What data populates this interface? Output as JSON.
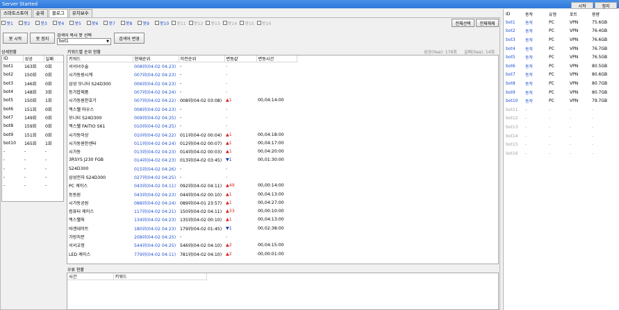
{
  "window": {
    "title": "Server Started"
  },
  "top_buttons": {
    "start": "시작",
    "stop": "정지"
  },
  "tabs": [
    "스마트스토어",
    "순위",
    "블로그",
    "유지보수"
  ],
  "bot_checks": [
    "봇1",
    "봇2",
    "봇3",
    "봇4",
    "봇5",
    "봇6",
    "봇7",
    "봇8",
    "봇9",
    "봇10",
    "봇11",
    "봇12",
    "봇13",
    "봇14",
    "봇15",
    "봇16"
  ],
  "controls": {
    "bot_start": "봇 시작",
    "bot_stop": "봇 정지",
    "copy_label": "검색어 복사 봇 선택",
    "selected_bot": "bot1",
    "change_keyword": "검색어 변경",
    "select_all": "전체선택",
    "deselect_all": "전체해제"
  },
  "detail": {
    "title": "상세현황",
    "headers": [
      "ID",
      "성공",
      "실패"
    ],
    "rows": [
      [
        "bot1",
        "163회",
        "0회"
      ],
      [
        "bot2",
        "150회",
        "0회"
      ],
      [
        "bot3",
        "146회",
        "0회"
      ],
      [
        "bot4",
        "148회",
        "3회"
      ],
      [
        "bot5",
        "150회",
        "1회"
      ],
      [
        "bot6",
        "151회",
        "0회"
      ],
      [
        "bot7",
        "149회",
        "0회"
      ],
      [
        "bot8",
        "159회",
        "0회"
      ],
      [
        "bot9",
        "151회",
        "0회"
      ],
      [
        "bot10",
        "165회",
        "1회"
      ],
      [
        "-",
        "-",
        "-"
      ],
      [
        "-",
        "-",
        "-"
      ],
      [
        "-",
        "-",
        "-"
      ],
      [
        "-",
        "-",
        "-"
      ],
      [
        "-",
        "-",
        "-"
      ]
    ]
  },
  "rank": {
    "title": "키워드별 순위 현황",
    "success_count": "성공(0ea): 176회",
    "fail_count": "실패(0ea): 14회",
    "headers": [
      "키워드",
      "현재순위",
      "이전순위",
      "변동값",
      "변동시간"
    ],
    "rows": [
      [
        "서서녀수술",
        "008위(04-02 04:23)",
        "-",
        "-",
        ""
      ],
      [
        "시가동원시계",
        "007위(04-02 04:23)",
        "-",
        "-",
        ""
      ],
      [
        "삼성 모니터 S24D300",
        "006위(04-02 04:23)",
        "-",
        "-",
        ""
      ],
      [
        "등가합체품",
        "007위(04-02 04:24)",
        "-",
        "-",
        ""
      ],
      [
        "시가동원한호기",
        "007위(04-02 04:22)",
        "008위(04-02 03:08)",
        "▲1",
        "00,04:14:00"
      ],
      [
        "맥스웰 마우스",
        "008위(04-02 04:23)",
        "-",
        "-",
        ""
      ],
      [
        "모니터 S24D300",
        "009위(04-02 04:25)",
        "-",
        "-",
        ""
      ],
      [
        "맥스웰 FAITIO S61",
        "010위(04-02 04:25)",
        "-",
        "-",
        ""
      ],
      [
        "시가동이상",
        "010위(04-02 04:22)",
        "011위(04-02 00:04)",
        "▲1",
        "00,04:18:00"
      ],
      [
        "시가동원한센터",
        "011위(04-02 04:24)",
        "012위(04-02 00:07)",
        "▲1",
        "00,04:17:00"
      ],
      [
        "시가동",
        "013위(04-02 04:23)",
        "014위(04-02 00:03)",
        "▲1",
        "00,04:20:00"
      ],
      [
        "3RSYS J230 FGB",
        "014위(04-02 04:23)",
        "013위(04-02 03:45)",
        "▼1",
        "00,01:30:00"
      ],
      [
        "S24D300",
        "015위(04-02 04:26)",
        "-",
        "-",
        ""
      ],
      [
        "삼성전자 S24D300",
        "027위(04-02 04:25)",
        "-",
        "-",
        ""
      ],
      [
        "PC 케이스",
        "043위(04-02 04:11)",
        "092위(04-02 04:11)",
        "▲49",
        "00,00:14:00"
      ],
      [
        "등동원",
        "043위(04-02 04:23)",
        "044위(04-02 00:10)",
        "▲1",
        "00,04:13:00"
      ],
      [
        "시가동공원",
        "088위(04-02 04:24)",
        "089위(04-01 23:57)",
        "▲1",
        "00,04:27:00"
      ],
      [
        "컴퓨터 케이스",
        "117위(04-02 04:21)",
        "150위(04-02 04:11)",
        "▲33",
        "00,00:10:00"
      ],
      [
        "맥스웰육",
        "134위(04-02 04:23)",
        "135위(04-02 00:10)",
        "▲1",
        "00,04:13:00"
      ],
      [
        "바겐데이트",
        "180위(04-02 04:23)",
        "179위(04-02 01:45)",
        "▼1",
        "00,02:38:00"
      ],
      [
        "가방처분",
        "208위(04-02 04:25)",
        "-",
        "-",
        ""
      ],
      [
        "서서교정",
        "544위(04-02 04:25)",
        "546위(04-02 04:10)",
        "▲2",
        "00,04:15:00"
      ],
      [
        "LED 케이스",
        "779위(04-02 04:11)",
        "781위(04-02 04:10)",
        "▲2",
        "00,00:01:00"
      ]
    ]
  },
  "errors": {
    "title": "오류 현황",
    "headers": [
      "시간",
      "키워드"
    ]
  },
  "bot_status": {
    "headers": [
      "ID",
      "동작",
      "유형",
      "포트",
      "용량"
    ],
    "rows": [
      [
        "bot1",
        "동작",
        "PC",
        "VPN",
        "75.6GB"
      ],
      [
        "bot2",
        "동작",
        "PC",
        "VPN",
        "76.4GB"
      ],
      [
        "bot3",
        "동작",
        "PC",
        "VPN",
        "76.6GB"
      ],
      [
        "bot4",
        "동작",
        "PC",
        "VPN",
        "76.7GB"
      ],
      [
        "bot5",
        "동작",
        "PC",
        "VPN",
        "76.5GB"
      ],
      [
        "bot6",
        "동작",
        "PC",
        "VPN",
        "80.5GB"
      ],
      [
        "bot7",
        "동작",
        "PC",
        "VPN",
        "80.6GB"
      ],
      [
        "bot8",
        "동작",
        "PC",
        "VPN",
        "80.7GB"
      ],
      [
        "bot9",
        "동작",
        "PC",
        "VPN",
        "80.7GB"
      ],
      [
        "bot10",
        "동작",
        "PC",
        "VPN",
        "79.7GB"
      ],
      [
        "bot11",
        "-",
        "-",
        "-",
        "-"
      ],
      [
        "bot12",
        "-",
        "-",
        "-",
        "-"
      ],
      [
        "bot13",
        "-",
        "-",
        "-",
        "-"
      ],
      [
        "bot14",
        "-",
        "-",
        "-",
        "-"
      ],
      [
        "bot15",
        "-",
        "-",
        "-",
        "-"
      ],
      [
        "bot16",
        "-",
        "-",
        "-",
        "-"
      ]
    ]
  },
  "colors": {
    "titlebar": "#2f78dc",
    "link_blue": "#1c4fd0",
    "up_red": "#d82020",
    "down_blue": "#1c3fa8"
  }
}
